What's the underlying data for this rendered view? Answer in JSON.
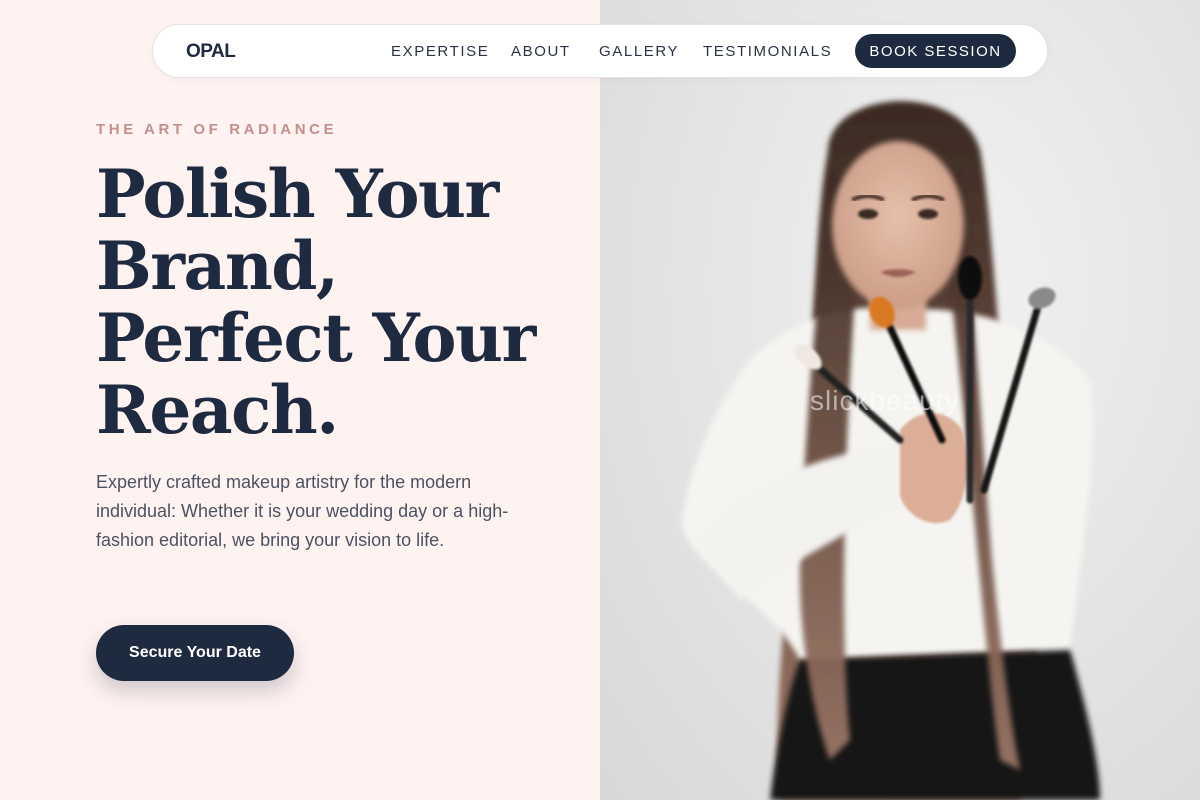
{
  "brand": {
    "logo": "OPAL"
  },
  "nav": {
    "links": [
      "EXPERTISE",
      "ABOUT",
      "GALLERY",
      "TESTIMONIALS"
    ],
    "cta": "BOOK SESSION"
  },
  "hero": {
    "eyebrow": "THE ART OF RADIANCE",
    "headline_lines": [
      "Polish Your",
      "Brand,",
      "Perfect Your",
      "Reach."
    ],
    "description": "Expertly crafted makeup artistry for the modern individual: Whether it is your wedding day or a high-fashion editorial, we bring your vision to life.",
    "cta": "Secure Your Date"
  },
  "image": {
    "watermark": "slickbeauty",
    "description_icon": "portrait-photo"
  },
  "colors": {
    "navy": "#1e2a3f",
    "blush_bg": "#fff3f2",
    "rose_accent": "#c48f8a",
    "body_text": "#4b5262"
  }
}
